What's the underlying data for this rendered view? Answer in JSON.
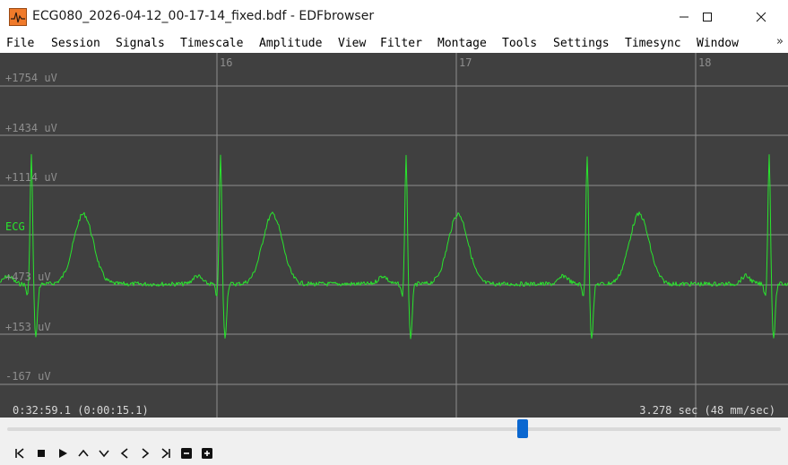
{
  "window": {
    "title": "ECG080_2026-04-12_00-17-14_fixed.bdf - EDFbrowser",
    "app_icon": "edfbrowser-app-icon",
    "controls": [
      "minimize-icon",
      "maximize-icon",
      "close-icon"
    ]
  },
  "menu": {
    "items": [
      "File",
      "Session",
      "Signals",
      "Timescale",
      "Amplitude",
      "View",
      "Filter",
      "Montage",
      "Tools",
      "Settings",
      "Timesync",
      "Window"
    ],
    "more": "»"
  },
  "display": {
    "background": "#404040",
    "trace_color": "#29e42d",
    "grid_color": "#8e8e8e",
    "time_marks": [
      "16",
      "17",
      "18"
    ],
    "amplitude_labels": [
      "+1754 uV",
      "+1434 uV",
      "+1114 uV",
      "+473 uV",
      "+153 uV",
      "-167 uV"
    ],
    "channel_label": "ECG",
    "status_left": "0:32:59.1 (0:00:15.1)",
    "status_right": "3.278 sec  (48 mm/sec)"
  },
  "scrollbar": {
    "position_fraction": 0.67,
    "thumb_color": "#0a67d0"
  },
  "toolbar": {
    "buttons": [
      "skip-to-start-icon",
      "stop-icon",
      "play-icon",
      "page-up-icon",
      "page-down-icon",
      "step-back-icon",
      "step-forward-icon",
      "skip-to-end-icon",
      "zoom-out-icon",
      "zoom-in-icon"
    ]
  }
}
